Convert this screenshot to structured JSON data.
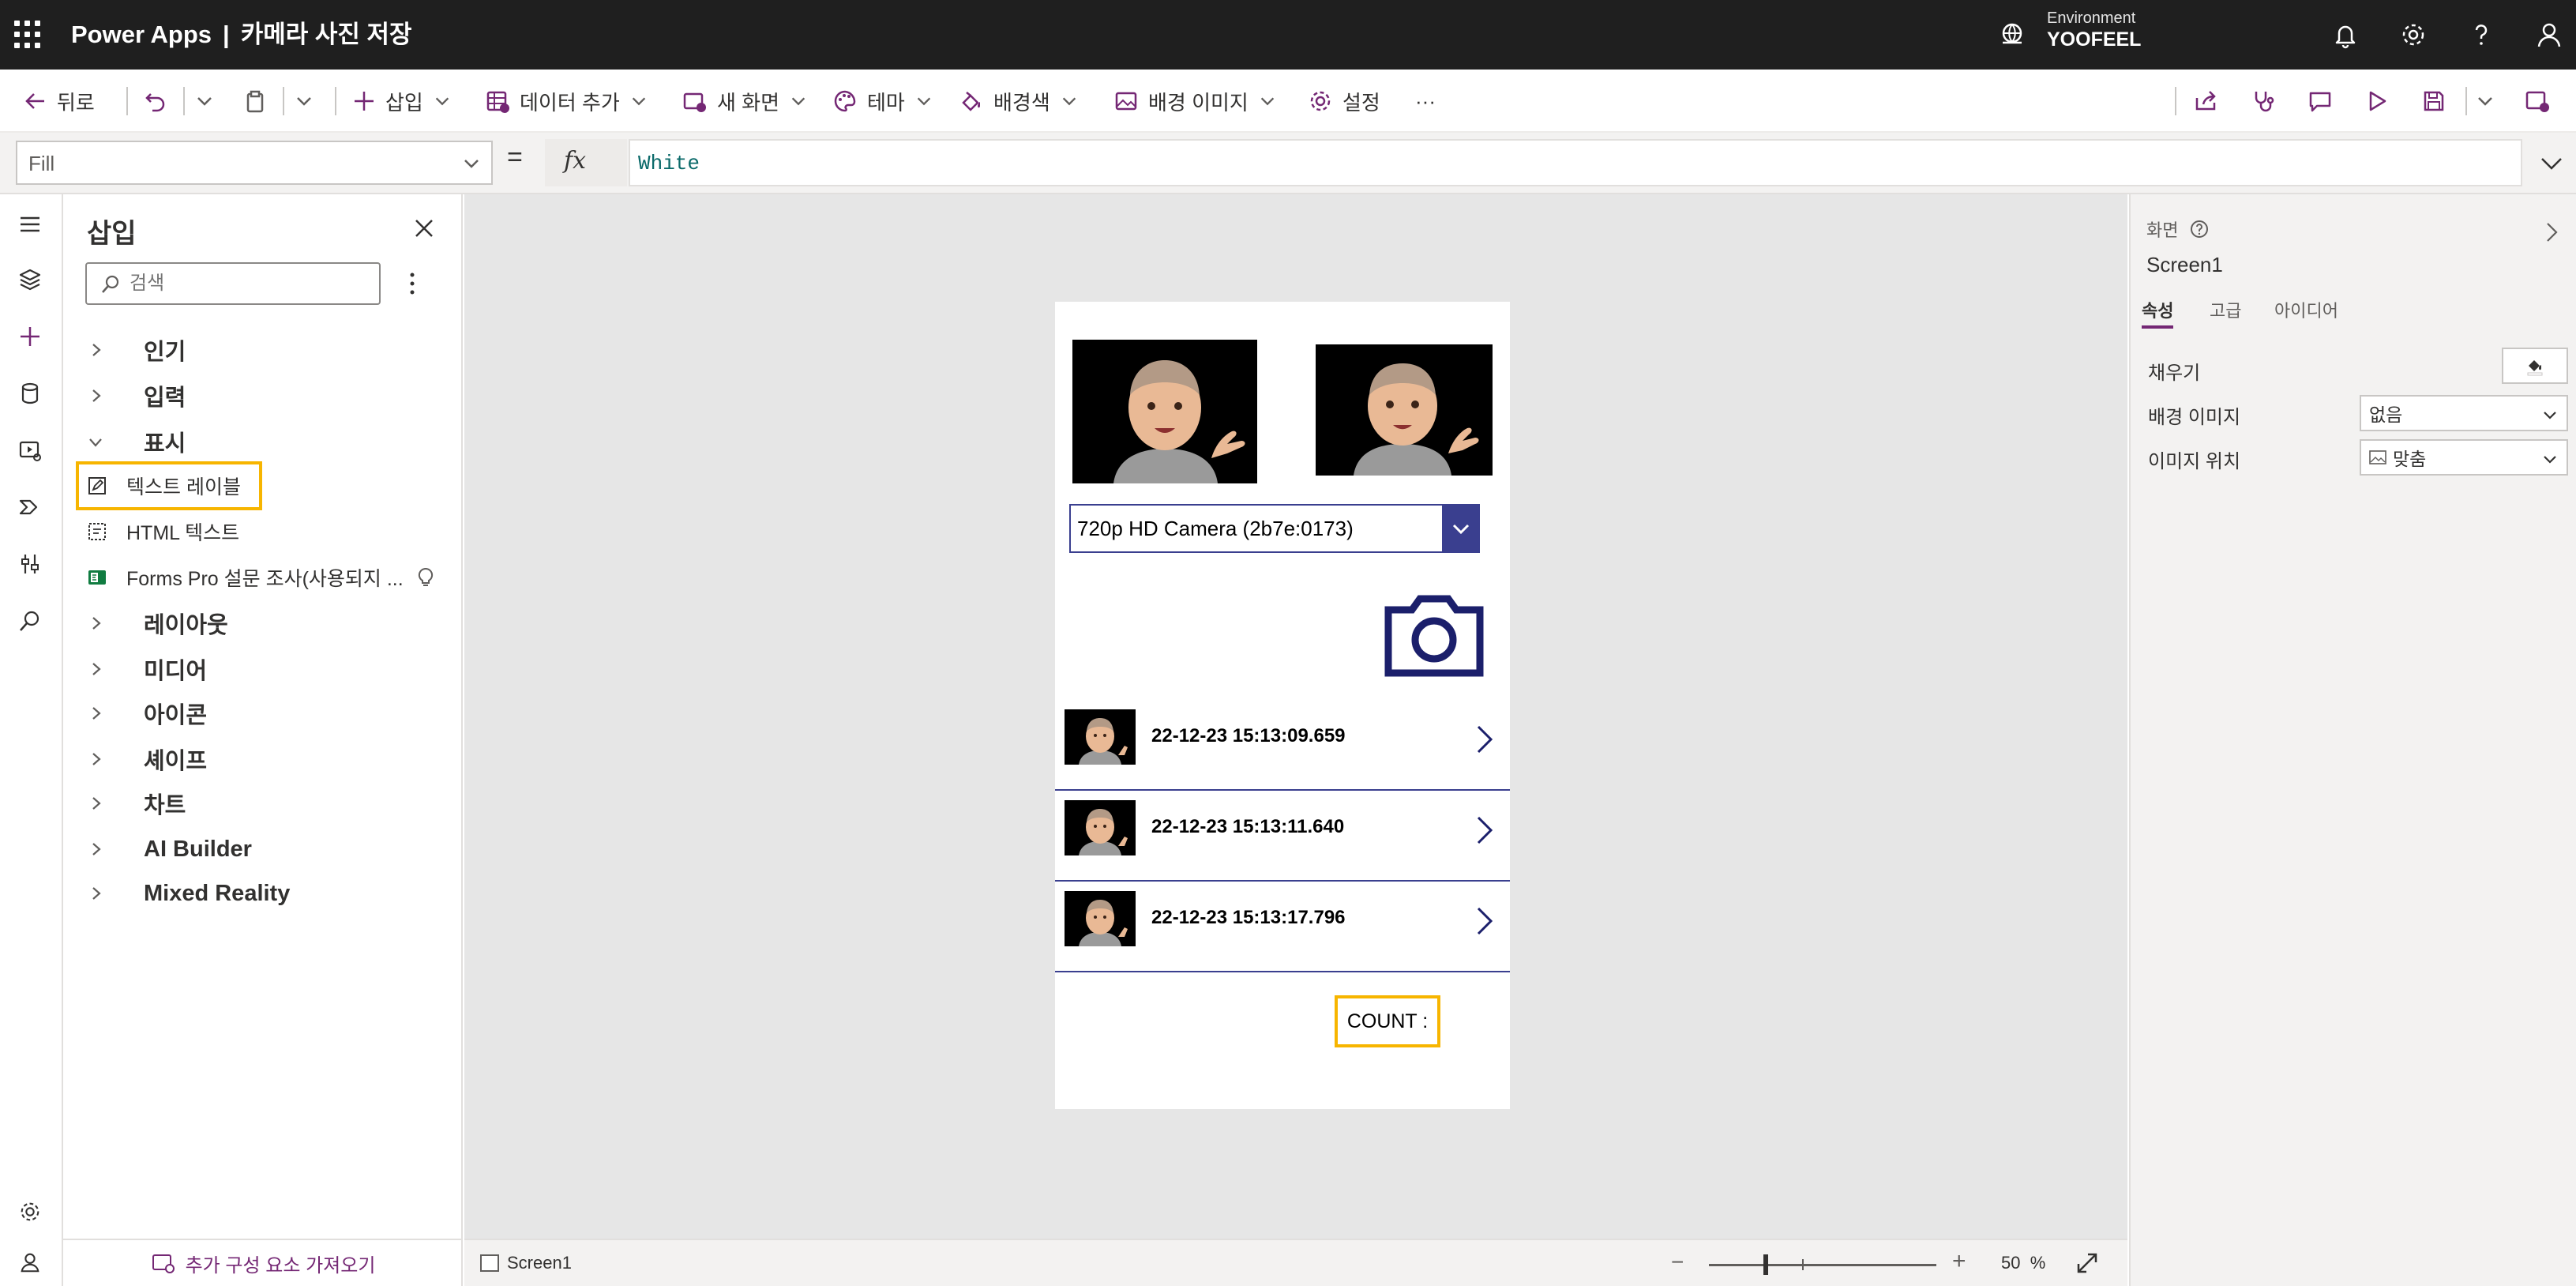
{
  "header": {
    "product": "Power Apps",
    "separator": "|",
    "app_title": "카메라 사진 저장",
    "environment_label": "Environment",
    "environment_name": "YOOFEEL"
  },
  "toolbar": {
    "back": "뒤로",
    "insert": "삽입",
    "add_data": "데이터 추가",
    "new_screen": "새 화면",
    "theme": "테마",
    "background_color": "배경색",
    "background_image": "배경 이미지",
    "settings": "설정",
    "more": "···"
  },
  "formula_bar": {
    "property": "Fill",
    "equals": "=",
    "fx": "fx",
    "formula": "White"
  },
  "insert_panel": {
    "title": "삽입",
    "search_placeholder": "검색",
    "categories": {
      "popular": "인기",
      "input": "입력",
      "display": "표시",
      "layout": "레이아웃",
      "media": "미디어",
      "icons": "아이콘",
      "shapes": "셰이프",
      "charts": "차트",
      "ai_builder": "AI Builder",
      "mixed_reality": "Mixed Reality"
    },
    "display_items": {
      "text_label": "텍스트 레이블",
      "html_text": "HTML 텍스트",
      "forms_pro": "Forms Pro 설문 조사(사용되지 ..."
    },
    "footer": "추가 구성 요소 가져오기"
  },
  "app_screen": {
    "camera_dropdown": "720p HD Camera (2b7e:0173)",
    "gallery": [
      {
        "timestamp": "22-12-23 15:13:09.659"
      },
      {
        "timestamp": "22-12-23 15:13:11.640"
      },
      {
        "timestamp": "22-12-23 15:13:17.796"
      }
    ],
    "count_label": "COUNT :"
  },
  "status_bar": {
    "screen_tab": "Screen1",
    "zoom_value": "50",
    "zoom_unit": "%",
    "zoom_minus": "−",
    "zoom_plus": "+"
  },
  "properties": {
    "kind": "화면",
    "name": "Screen1",
    "tabs": [
      "속성",
      "고급",
      "아이디어"
    ],
    "fill_label": "채우기",
    "bg_image_label": "배경 이미지",
    "bg_image_value": "없음",
    "image_position_label": "이미지 위치",
    "image_position_value": "맞춤"
  },
  "colors": {
    "header_bg": "#1f1f1f",
    "accent_purple": "#742774",
    "app_blue": "#3a3f8f",
    "camera_icon": "#1b1f6b",
    "highlight": "#f7b500",
    "canvas_bg": "#e6e6e6"
  },
  "icons": {
    "waffle": "app-launcher-icon",
    "bell": "notification-bell-icon",
    "gear": "settings-gear-icon",
    "help": "help-icon",
    "user": "user-icon"
  }
}
